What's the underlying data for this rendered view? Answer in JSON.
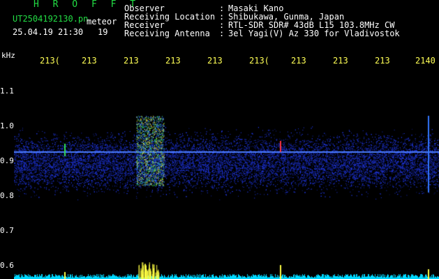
{
  "header": {
    "title": "H R O F F T",
    "filename": "UT2504192130.pn",
    "filename_suffix": "meteor",
    "datetime": "25.04.19 21:30",
    "count": "19"
  },
  "station": {
    "labels": [
      "Observer",
      "Receiving Location",
      "Receiver",
      "Receiving Antenna"
    ],
    "colons": [
      ":",
      ":",
      ":",
      ":"
    ],
    "values": [
      "Masaki Kano",
      "Shibukawa, Gunma, Japan",
      "RTL-SDR SDR# 43dB L15 103.8MHz CW",
      "3el Yagi(V) Az 330 for Vladivostok"
    ]
  },
  "axes": {
    "y_unit": "kHz",
    "y_ticks": [
      "1.1",
      "1.0",
      "0.9",
      "0.8",
      "0.7",
      "0.6"
    ],
    "x_ticks": [
      "213(",
      "213",
      "213",
      "213",
      "213",
      "213(",
      "213",
      "213",
      "213",
      "2140"
    ]
  },
  "colors": {
    "background": "#000000",
    "noise": "#1a2cff",
    "carrier": "#3366ff",
    "echo": "#ffff44",
    "baseline": "#00e5ff"
  }
}
